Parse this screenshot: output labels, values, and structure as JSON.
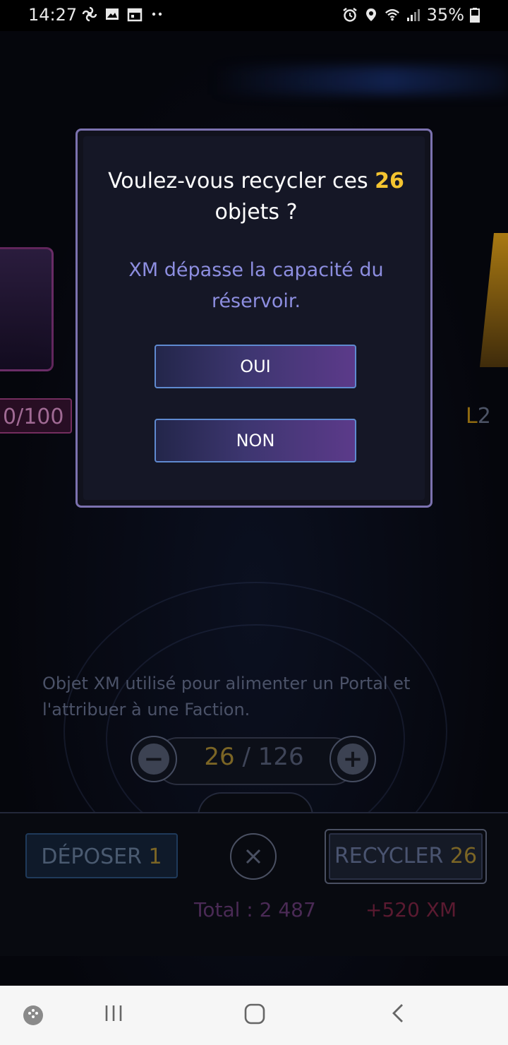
{
  "status_bar": {
    "time": "14:27",
    "battery": "35%"
  },
  "background": {
    "left_item_level": "0/100",
    "right_item_level_prefix": "L",
    "right_item_level_num": "2",
    "description": "Objet XM utilisé pour alimenter un Portal et l'attribuer à une Faction.",
    "stepper": {
      "current": "26",
      "separator": "/",
      "total": "126",
      "minus": "−",
      "plus": "+"
    },
    "deposit_label": "DÉPOSER",
    "deposit_count": "1",
    "recycle_label": "RECYCLER",
    "recycle_count": "26",
    "total_text": "Total : 2 487",
    "xm_text": "+520 XM"
  },
  "dialog": {
    "question_prefix": "Voulez-vous recycler ces",
    "question_count": "26",
    "question_suffix": "objets ?",
    "warning": "XM dépasse la capacité du réservoir.",
    "yes_label": "OUI",
    "no_label": "NON"
  },
  "colors": {
    "accent_gold": "#f4c430",
    "warning_text": "#8d8ee0",
    "dialog_border": "#7c72b0"
  }
}
